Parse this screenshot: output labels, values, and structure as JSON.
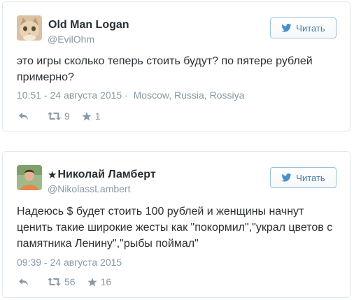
{
  "colors": {
    "text": "#292f33",
    "muted": "#8899a6",
    "border": "#e1e8ed",
    "follow_blue": "#4a7ba6"
  },
  "tweets": [
    {
      "display_name": "Old Man Logan",
      "verified_star": "",
      "handle": "@EvilOhm",
      "follow_label": "Читать",
      "text": "это игры сколько теперь стоить будут? по пятере рублей примерно?",
      "timestamp": "10:51 - 24 августа 2015",
      "separator": "·",
      "location": "Moscow, Russia, Rossiya",
      "retweets": "9",
      "likes": "1"
    },
    {
      "display_name": "Николай Ламберт",
      "verified_star": "★",
      "handle": "@NikolassLambert",
      "follow_label": "Читать",
      "text": "Надеюсь $ будет стоить 100 рублей и женщины начнут ценить такие широкие жесты как \"покормил\",\"украл цветов с памятника Ленину\",\"рыбы поймал\"",
      "timestamp": "09:39 - 24 августа 2015",
      "separator": "",
      "location": "",
      "retweets": "56",
      "likes": "16"
    }
  ]
}
